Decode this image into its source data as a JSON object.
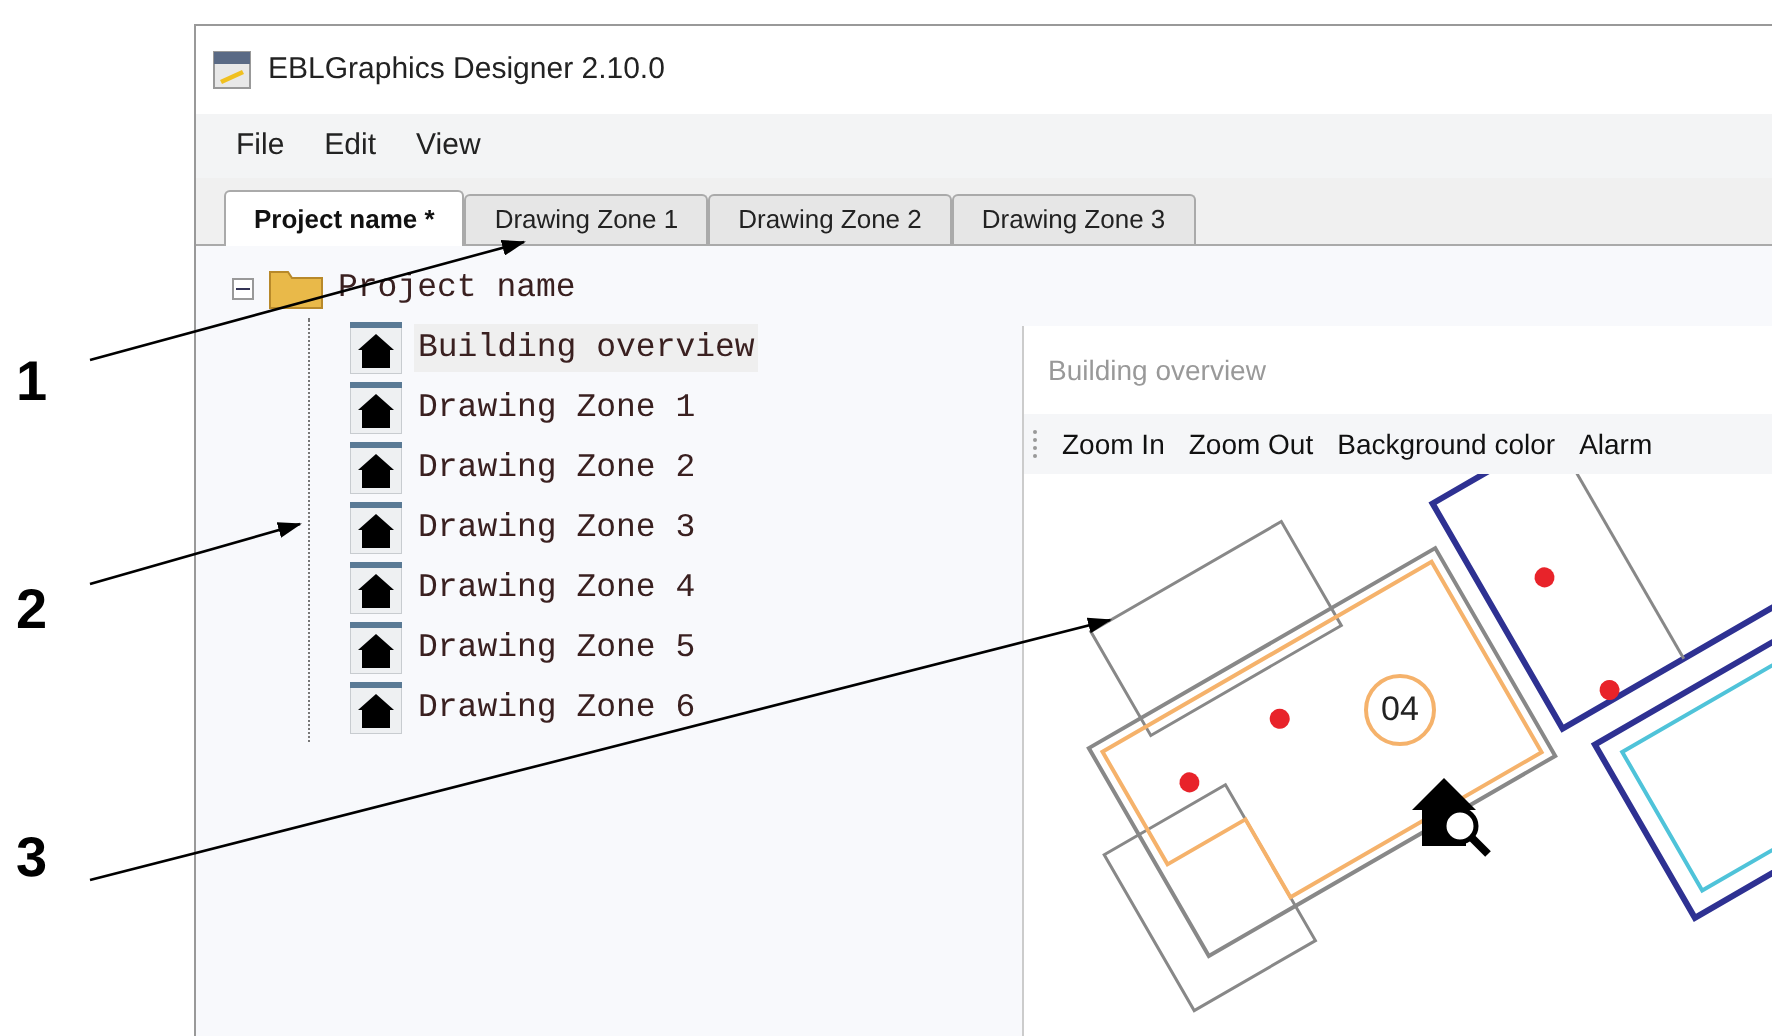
{
  "window": {
    "title": "EBLGraphics Designer 2.10.0"
  },
  "menu": [
    "File",
    "Edit",
    "View"
  ],
  "tabs": [
    {
      "label": "Project name *",
      "selected": true
    },
    {
      "label": "Drawing Zone 1",
      "selected": false
    },
    {
      "label": "Drawing Zone 2",
      "selected": false
    },
    {
      "label": "Drawing Zone 3",
      "selected": false
    }
  ],
  "tree": {
    "label": "Project name",
    "expanded": true,
    "children": [
      {
        "label": "Building overview",
        "selected": true
      },
      {
        "label": "Drawing Zone 1",
        "selected": false
      },
      {
        "label": "Drawing Zone 2",
        "selected": false
      },
      {
        "label": "Drawing Zone 3",
        "selected": false
      },
      {
        "label": "Drawing Zone 4",
        "selected": false
      },
      {
        "label": "Drawing Zone 5",
        "selected": false
      },
      {
        "label": "Drawing Zone 6",
        "selected": false
      }
    ]
  },
  "overview": {
    "title": "Building overview",
    "toolbar": [
      "Zoom In",
      "Zoom Out",
      "Background color",
      "Alarm"
    ],
    "zone_label": "04"
  },
  "callouts": [
    "1",
    "2",
    "3"
  ]
}
